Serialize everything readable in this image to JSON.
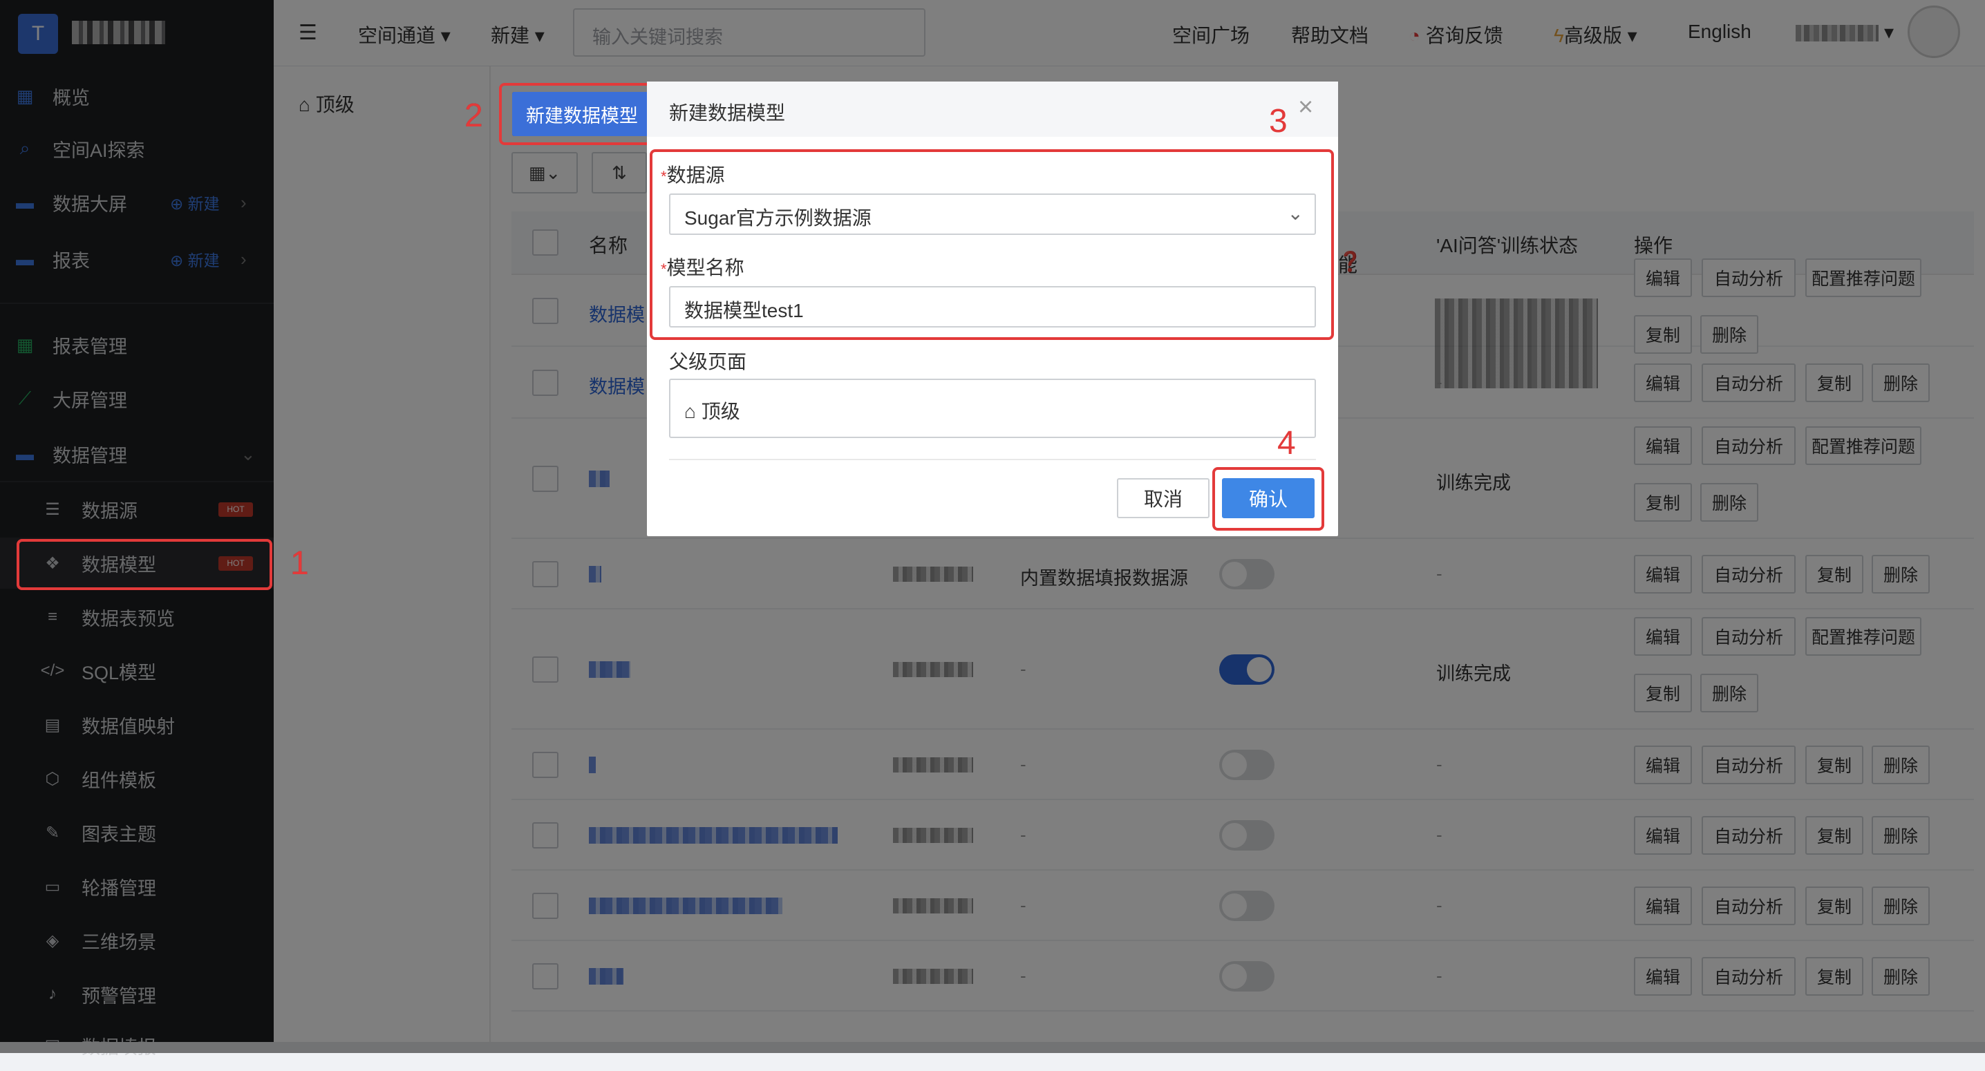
{
  "sidebar": {
    "logo_letter": "T",
    "items": [
      {
        "label": "概览",
        "icon": "dashboard-icon"
      },
      {
        "label": "空间AI探索",
        "icon": "search-icon"
      },
      {
        "label": "数据大屏",
        "icon": "folder-icon",
        "extra": "新建"
      },
      {
        "label": "报表",
        "icon": "folder-icon",
        "extra": "新建"
      },
      {
        "label": "报表管理",
        "icon": "grid-icon"
      },
      {
        "label": "大屏管理",
        "icon": "chart-icon"
      },
      {
        "label": "数据管理",
        "icon": "folder-icon"
      }
    ],
    "sub_items": [
      {
        "label": "数据源",
        "hot": "HOT"
      },
      {
        "label": "数据模型",
        "hot": "HOT"
      },
      {
        "label": "数据表预览"
      },
      {
        "label": "SQL模型"
      },
      {
        "label": "数据值映射"
      },
      {
        "label": "组件模板"
      },
      {
        "label": "图表主题"
      },
      {
        "label": "轮播管理"
      },
      {
        "label": "三维场景"
      },
      {
        "label": "预警管理"
      },
      {
        "label": "数据填报"
      }
    ]
  },
  "topbar": {
    "space_channel": "空间通道",
    "new": "新建",
    "search_placeholder": "输入关键词搜索",
    "space_square": "空间广场",
    "help_docs": "帮助文档",
    "feedback": "咨询反馈",
    "advanced": "高级版",
    "language": "English"
  },
  "content": {
    "breadcrumb": "顶级",
    "new_model_button": "新建数据模型",
    "table": {
      "col_name": "名称",
      "col_ability": "能",
      "col_ai_status": "'AI问答'训练状态",
      "col_actions": "操作",
      "row_name_prefix": "数据模",
      "cell_builtin_source": "内置数据填报数据源",
      "status_trained": "训练完成",
      "dash": "-",
      "btn_edit": "编辑",
      "btn_auto": "自动分析",
      "btn_config": "配置推荐问题",
      "btn_copy": "复制",
      "btn_delete": "删除"
    }
  },
  "modal": {
    "title": "新建数据模型",
    "field_source_label": "数据源",
    "field_source_value": "Sugar官方示例数据源",
    "field_name_label": "模型名称",
    "field_name_value": "数据模型test1",
    "field_parent_label": "父级页面",
    "field_parent_value": "顶级",
    "cancel": "取消",
    "confirm": "确认",
    "required_mark": "*"
  },
  "annotations": [
    "1",
    "2",
    "3",
    "4"
  ],
  "colors": {
    "accent": "#3b6fd8",
    "annotation": "#e33a3a",
    "sidebar": "#1d1e21"
  }
}
